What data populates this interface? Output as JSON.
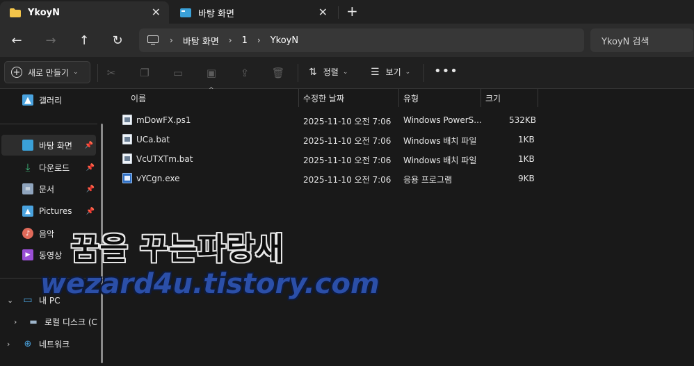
{
  "tabs": [
    {
      "label": "YkoyN",
      "active": true,
      "icon": "folder-icon"
    },
    {
      "label": "바탕 화면",
      "active": false,
      "icon": "desktop-icon"
    }
  ],
  "new_tab_symbol": "+",
  "breadcrumb": [
    "바탕 화면",
    "1",
    "YkoyN"
  ],
  "search_placeholder": "YkoyN 검색",
  "commands": {
    "new_label": "새로 만들기",
    "sort_label": "정렬",
    "view_label": "보기"
  },
  "sidebar": {
    "gallery": "갤러리",
    "quick": [
      {
        "label": "바탕 화면",
        "icon": "desktop-icon",
        "pinned": true,
        "selected": true
      },
      {
        "label": "다운로드",
        "icon": "download-icon",
        "pinned": true
      },
      {
        "label": "문서",
        "icon": "document-icon",
        "pinned": true
      },
      {
        "label": "Pictures",
        "icon": "pictures-icon",
        "pinned": true
      },
      {
        "label": "음악",
        "icon": "music-icon",
        "pinned": false
      },
      {
        "label": "동영상",
        "icon": "video-icon",
        "pinned": false
      }
    ],
    "this_pc": "내 PC",
    "local_disk": "로컬 디스크 (C",
    "network": "네트워크"
  },
  "columns": [
    "이름",
    "수정한 날짜",
    "유형",
    "크기"
  ],
  "files": [
    {
      "name": "mDowFX.ps1",
      "modified": "2025-11-10 오전 7:06",
      "type": "Windows PowerS...",
      "size": "532KB",
      "icon": "powershell-file-icon"
    },
    {
      "name": "UCa.bat",
      "modified": "2025-11-10 오전 7:06",
      "type": "Windows 배치 파일",
      "size": "1KB",
      "icon": "batch-file-icon"
    },
    {
      "name": "VcUTXTm.bat",
      "modified": "2025-11-10 오전 7:06",
      "type": "Windows 배치 파일",
      "size": "1KB",
      "icon": "batch-file-icon"
    },
    {
      "name": "vYCgn.exe",
      "modified": "2025-11-10 오전 7:06",
      "type": "응용 프로그램",
      "size": "9KB",
      "icon": "exe-file-icon"
    }
  ],
  "watermark": {
    "line1": "꿈을 꾸는파랑새",
    "line2": "wezard4u.tistory.com"
  },
  "colors": {
    "background": "#191919",
    "tab_active": "#2c2c2c",
    "folder": "#f4c54a",
    "accent_blue": "#4aa3df"
  }
}
